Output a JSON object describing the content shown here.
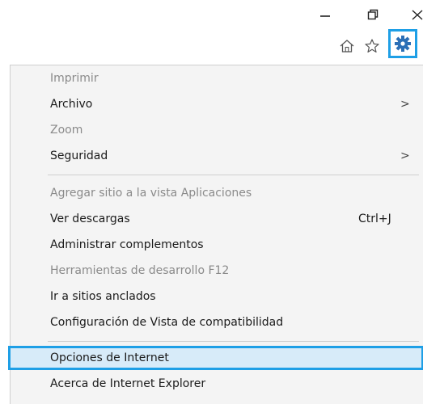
{
  "window_controls": {
    "minimize_icon": "minimize-icon",
    "restore_icon": "restore-icon",
    "close_icon": "close-icon"
  },
  "toolbar": {
    "home_icon": "home-icon",
    "favorites_icon": "star-icon",
    "tools_icon": "gear-icon",
    "accent": "#1e9fe6"
  },
  "menu": {
    "items": [
      {
        "label": "Imprimir",
        "disabled": true
      },
      {
        "label": "Archivo",
        "submenu": ">"
      },
      {
        "label": "Zoom",
        "disabled": true
      },
      {
        "label": "Seguridad",
        "submenu": ">"
      },
      {
        "label": "Agregar sitio a la vista Aplicaciones",
        "disabled": true
      },
      {
        "label": "Ver descargas",
        "shortcut": "Ctrl+J"
      },
      {
        "label": "Administrar complementos"
      },
      {
        "label": "Herramientas de desarrollo F12",
        "disabled": true
      },
      {
        "label": "Ir a sitios anclados"
      },
      {
        "label": "Configuración de Vista de compatibilidad"
      },
      {
        "label": "Opciones de Internet",
        "highlighted": true
      },
      {
        "label": "Acerca de Internet Explorer"
      }
    ]
  }
}
